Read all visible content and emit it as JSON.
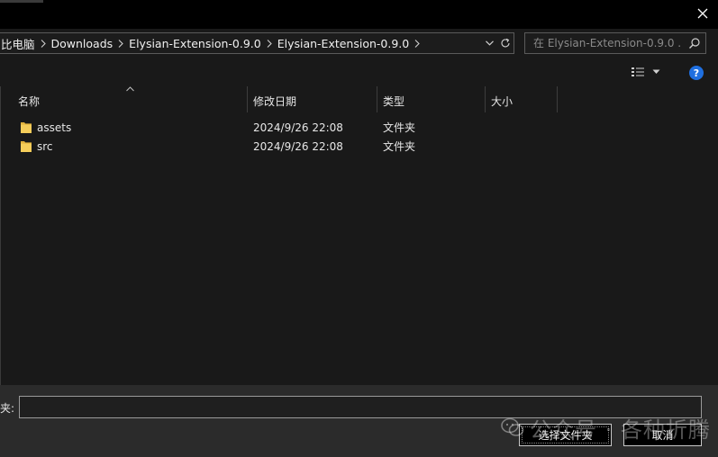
{
  "window": {
    "close_icon": "close-icon"
  },
  "address_bar": {
    "crumbs": [
      "比电脑",
      "Downloads",
      "Elysian-Extension-0.9.0",
      "Elysian-Extension-0.9.0"
    ],
    "dropdown_icon": "chevron-down-icon",
    "refresh_icon": "refresh-icon"
  },
  "search": {
    "placeholder": "在 Elysian-Extension-0.9.0 ...",
    "icon": "search-icon"
  },
  "toolbar": {
    "view_icon": "view-details-icon",
    "help_label": "?"
  },
  "columns": {
    "name": "名称",
    "modified": "修改日期",
    "type": "类型",
    "size": "大小"
  },
  "files": [
    {
      "name": "assets",
      "modified": "2024/9/26 22:08",
      "type": "文件夹",
      "icon": "folder-icon"
    },
    {
      "name": "src",
      "modified": "2024/9/26 22:08",
      "type": "文件夹",
      "icon": "folder-icon"
    }
  ],
  "bottom": {
    "folder_label": "夹:",
    "folder_value": "",
    "select_button": "选择文件夹",
    "cancel_button": "取消"
  },
  "watermark": {
    "text": "公众号 · 各种折腾"
  },
  "colors": {
    "background": "#191919",
    "titlebar": "#000000",
    "bottom_panel": "#2b2b2b",
    "folder": "#f2c94c",
    "help": "#1f6fe0"
  }
}
